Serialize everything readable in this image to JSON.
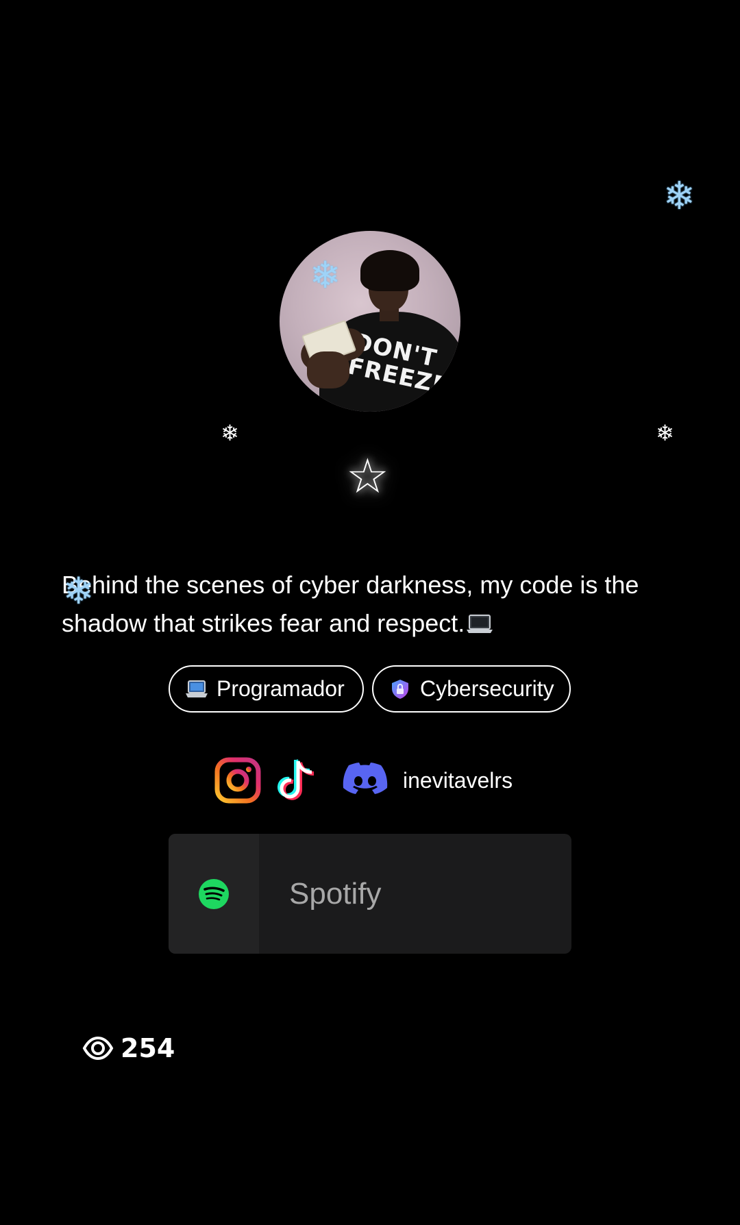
{
  "profile": {
    "avatar_icon": "avatar-photo",
    "avatar_shirt_text": "DON'T FREEZE",
    "badge_icon": "star-icon",
    "badge_glyph": "☆",
    "bio": "Behind the scenes of cyber darkness, my code is the shadow that strikes fear and respect."
  },
  "tags": [
    {
      "label": "Programador",
      "icon": "laptop-icon"
    },
    {
      "label": "Cybersecurity",
      "icon": "shield-lock-icon"
    }
  ],
  "socials": {
    "instagram_icon": "instagram-icon",
    "tiktok_icon": "tiktok-icon",
    "discord_icon": "discord-icon",
    "discord_username": "inevitavelrs"
  },
  "spotify": {
    "label": "Spotify",
    "icon": "spotify-icon",
    "accent": "#1ed760"
  },
  "stats": {
    "views_icon": "eye-icon",
    "views": "254"
  },
  "decor": {
    "snowflake_glyph": "❄",
    "snowflake_color": "#9fd3f7",
    "star_glow": "#ffffff"
  },
  "colors": {
    "background": "#000000",
    "card": "#1b1b1c",
    "discord": "#5865f2",
    "text": "#ffffff"
  }
}
